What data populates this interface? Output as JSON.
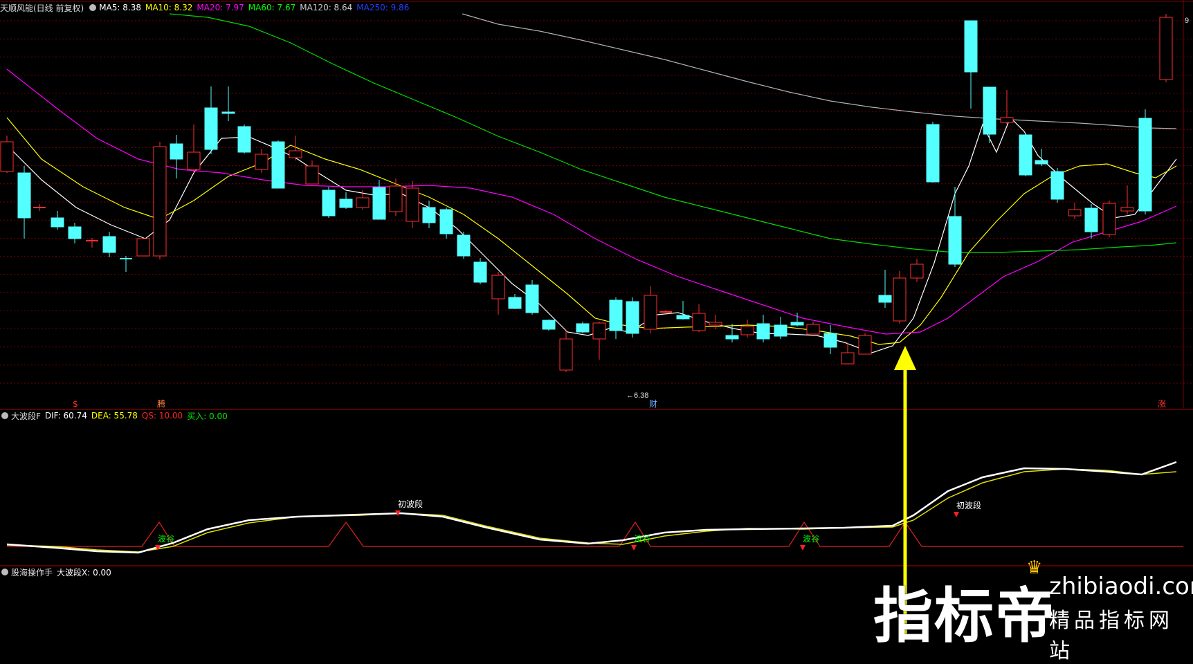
{
  "main_panel": {
    "title": "天顺风能(日线 前复权)",
    "ma": [
      {
        "label": "MA5: 8.38",
        "color": "#ffffff"
      },
      {
        "label": "MA10: 8.32",
        "color": "#ffff00"
      },
      {
        "label": "MA20: 7.97",
        "color": "#ff00ff"
      },
      {
        "label": "MA60: 7.67",
        "color": "#00ff00"
      },
      {
        "label": "MA120: 8.64",
        "color": "#c0c0c0"
      },
      {
        "label": "MA250: 9.86",
        "color": "#0000ff"
      }
    ],
    "low_marker": "6.38",
    "high_marker": "9",
    "badges": [
      {
        "text": "$",
        "color": "#ff3030"
      },
      {
        "text": "腾",
        "color": "#ff8040"
      },
      {
        "text": "财",
        "color": "#66aaff"
      },
      {
        "text": "涨",
        "color": "#ff3030"
      }
    ]
  },
  "indicator_panel": {
    "name": "大波段F",
    "values": [
      {
        "label": "DIF: 60.74",
        "color": "#ffffff"
      },
      {
        "label": "DEA: 55.78",
        "color": "#ffff00"
      },
      {
        "label": "QS: 10.00",
        "color": "#ff2020"
      },
      {
        "label": "买入: 0.00",
        "color": "#00e000"
      }
    ],
    "annotations": [
      {
        "text": "波谷",
        "color": "#00ff00"
      },
      {
        "text": "初波段",
        "color": "#ffffff"
      },
      {
        "text": "波谷",
        "color": "#00ff00"
      },
      {
        "text": "波谷",
        "color": "#00ff00"
      },
      {
        "text": "初波段",
        "color": "#ffffff"
      }
    ]
  },
  "bottom_panel": {
    "name": "股海操作手",
    "values": [
      {
        "label": "大波段X: 0.00",
        "color": "#ffffff"
      }
    ]
  },
  "logo": {
    "big_text": "指标帝",
    "url": "zhibiaodi.com",
    "slogan": "精品指标网站"
  },
  "colors": {
    "up": "#ff3030",
    "down": "#54ffff",
    "grid": "#7a0000",
    "arrow": "#ffff00"
  }
}
